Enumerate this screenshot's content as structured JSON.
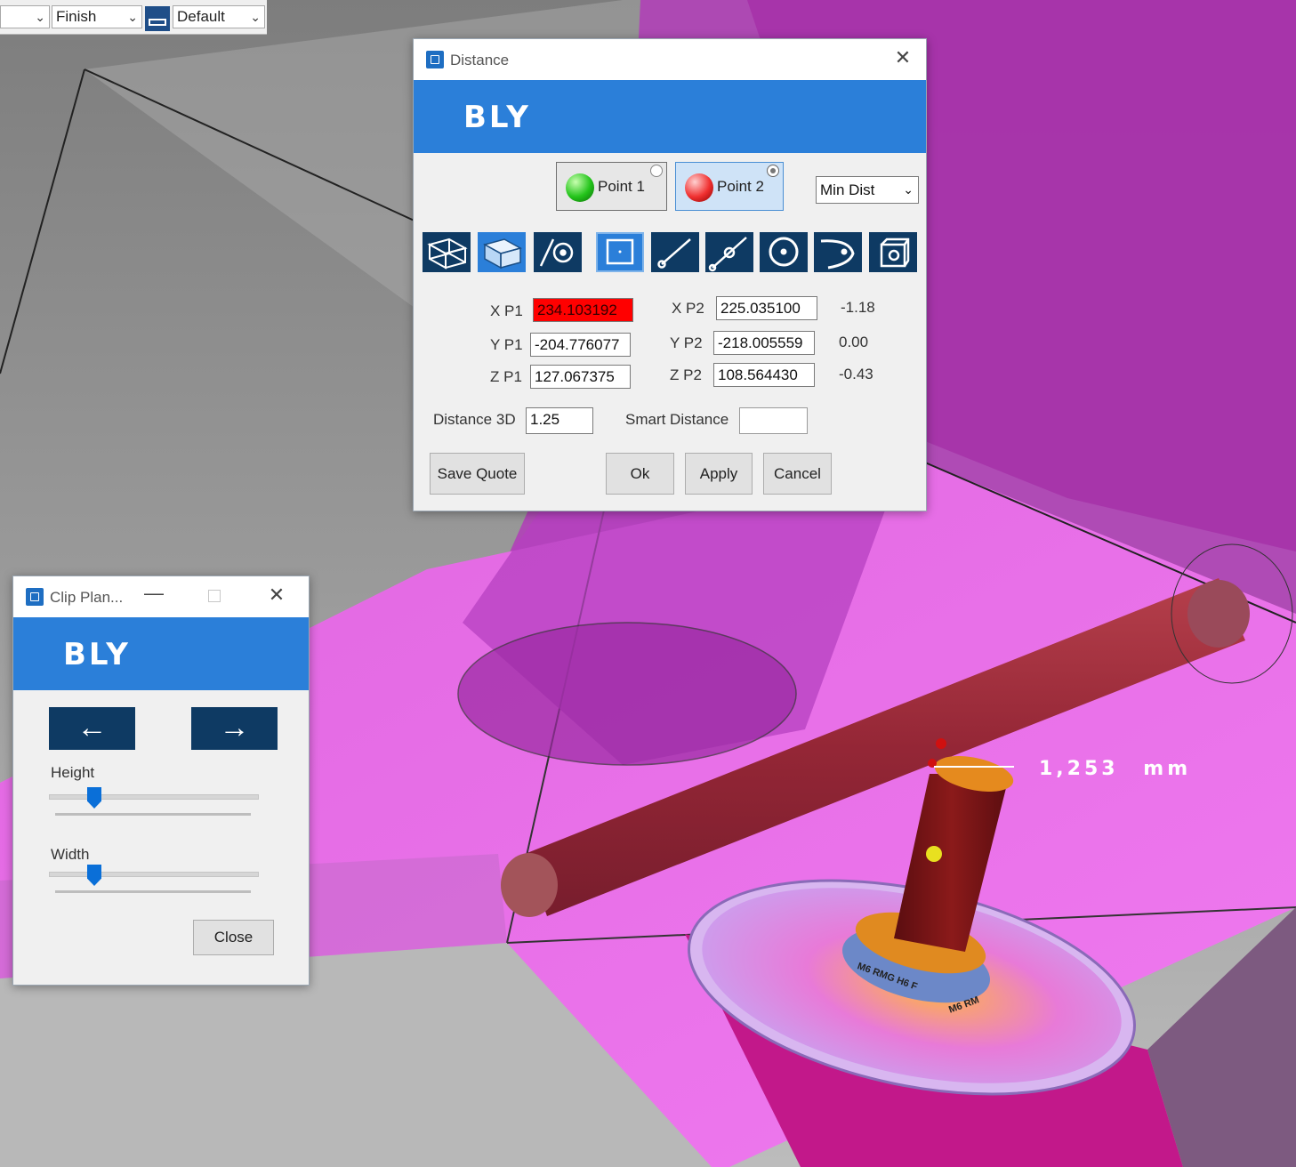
{
  "toolbar": {
    "combo_finish": "Finish",
    "combo_default": "Default"
  },
  "viewport": {
    "measurement_value": "1,253",
    "measurement_unit": "mm",
    "part_label_1": "M6 RMG H6 F",
    "part_label_2": "M6 RM"
  },
  "distance_dialog": {
    "title": "Distance",
    "brand": "BLY",
    "point1_label": "Point 1",
    "point2_label": "Point 2",
    "mode_value": "Min Dist",
    "xp1_label": "X P1",
    "yp1_label": "Y P1",
    "zp1_label": "Z P1",
    "xp2_label": "X P2",
    "yp2_label": "Y P2",
    "zp2_label": "Z P2",
    "xp1_value": "234.103192",
    "yp1_value": "-204.776077",
    "zp1_value": "127.067375",
    "xp2_value": "225.035100",
    "yp2_value": "-218.005559",
    "zp2_value": "108.564430",
    "dx": "-1.18",
    "dy": "0.00",
    "dz": "-0.43",
    "distance3d_label": "Distance 3D",
    "distance3d_value": "1.25",
    "smart_distance_label": "Smart Distance",
    "smart_distance_value": "",
    "save_quote": "Save Quote",
    "ok": "Ok",
    "apply": "Apply",
    "cancel": "Cancel",
    "tools": [
      "wireframe-box-icon",
      "solid-box-icon",
      "line-circle-icon",
      "plane-square-icon",
      "line-icon",
      "line-point-icon",
      "circle-center-icon",
      "arc-icon",
      "cube-hole-icon"
    ]
  },
  "clip_dialog": {
    "title": "Clip Plan...",
    "brand": "BLY",
    "height_label": "Height",
    "width_label": "Width",
    "height_value": 0.22,
    "width_value": 0.22,
    "close": "Close"
  },
  "colors": {
    "accent": "#2b7fd9",
    "navy": "#0e3a63",
    "magenta": "#e05ce0",
    "rod": "#8b1a1a",
    "error": "#ff0000"
  }
}
